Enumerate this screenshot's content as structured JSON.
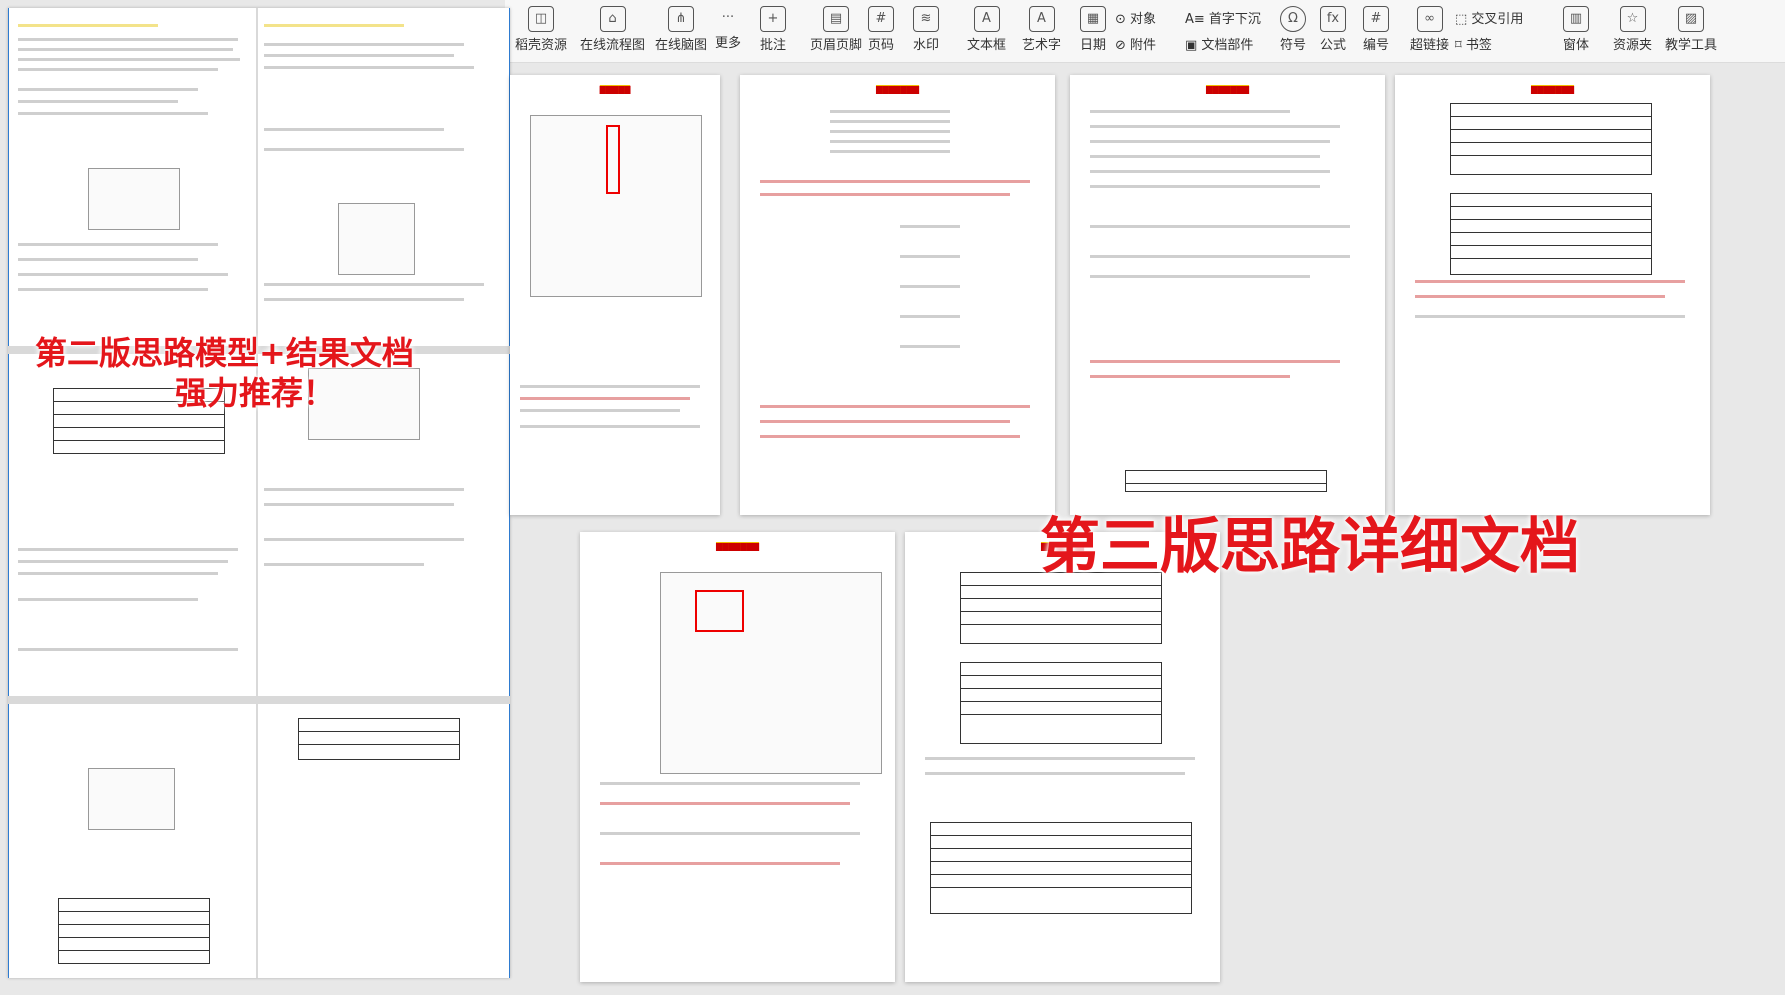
{
  "toolbar": {
    "items": [
      "稻壳资源",
      "在线流程图",
      "在线脑图",
      "更多",
      "批注",
      "页眉页脚",
      "页码",
      "水印",
      "文本框",
      "艺术字",
      "日期",
      "符号",
      "公式",
      "编号",
      "超链接",
      "窗体",
      "资源夹",
      "教学工具"
    ],
    "row_items": [
      "对象",
      "首字下沉",
      "交叉引用",
      "附件",
      "文档部件",
      "书签"
    ]
  },
  "overlays": {
    "left_line1": "第二版思路模型+结果文档",
    "left_line2": "强力推荐！",
    "right": "第三版思路详细文档"
  },
  "colors": {
    "overlay": "#e4161b",
    "header_highlight": "#ffff00"
  }
}
